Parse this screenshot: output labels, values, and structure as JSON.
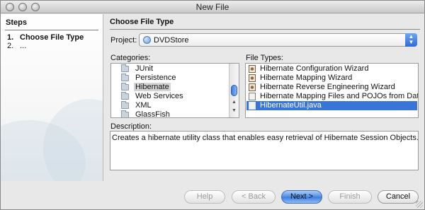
{
  "window": {
    "title": "New File"
  },
  "steps": {
    "heading": "Steps",
    "items": [
      {
        "num": "1.",
        "label": "Choose File Type"
      },
      {
        "num": "2.",
        "label": "..."
      }
    ]
  },
  "main": {
    "heading": "Choose File Type",
    "project_label": "Project:",
    "project_value": "DVDStore",
    "categories_label": "Categories:",
    "file_types_label": "File Types:",
    "categories": [
      "JUnit",
      "Persistence",
      "Hibernate",
      "Web Services",
      "XML",
      "GlassFish"
    ],
    "selected_category": "Hibernate",
    "file_types": [
      "Hibernate Configuration Wizard",
      "Hibernate Mapping Wizard",
      "Hibernate Reverse Engineering Wizard",
      "Hibernate Mapping Files and POJOs from Database",
      "HibernateUtil.java"
    ],
    "selected_file_type": "HibernateUtil.java",
    "description_label": "Description:",
    "description_text": "Creates a hibernate utility class that enables easy retrieval of Hibernate Session Objects."
  },
  "buttons": {
    "help": "Help",
    "back": "< Back",
    "next": "Next >",
    "finish": "Finish",
    "cancel": "Cancel"
  },
  "colors": {
    "selection": "#3875d7",
    "primary_button": "#4e8de7"
  }
}
